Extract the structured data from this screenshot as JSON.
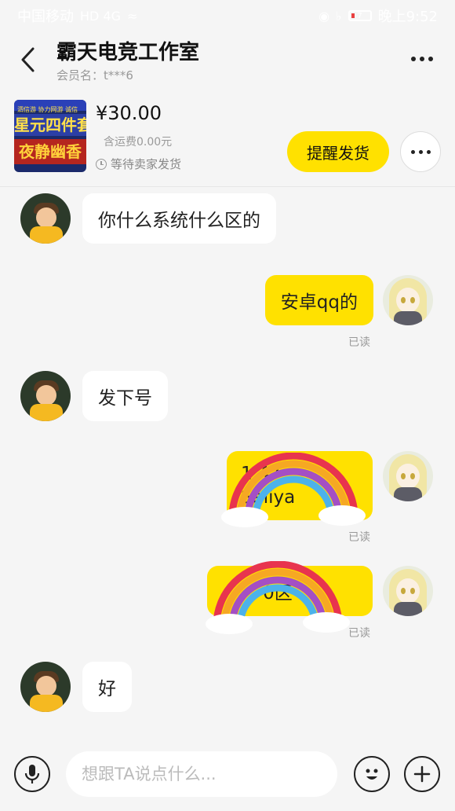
{
  "status_bar": {
    "carrier": "中国移动",
    "network": "HD 4G",
    "battery": "7",
    "time": "晚上9:52"
  },
  "header": {
    "shop_name": "霸天电竞工作室",
    "member_label": "会员名：t***6"
  },
  "order": {
    "thumb_top": "泗信游  协力网游  诚信",
    "thumb_title": "星元四件套",
    "thumb_sub": "夜静幽香",
    "price": "¥30.00",
    "shipping": "含运费0.00元",
    "status": "等待卖家发货",
    "remind_label": "提醒发货"
  },
  "messages": [
    {
      "side": "in",
      "text": "你什么系统什么区的"
    },
    {
      "side": "out",
      "text": "安卓qq的",
      "read": "已读"
    },
    {
      "side": "in",
      "text": "发下号"
    },
    {
      "side": "out",
      "text": "1      47",
      "text2": "Saliya",
      "read": "已读"
    },
    {
      "side": "out",
      "text": "       0区",
      "read": "已读"
    },
    {
      "side": "in",
      "text": "好"
    }
  ],
  "input": {
    "placeholder": "想跟TA说点什么..."
  },
  "colors": {
    "accent": "#ffe100",
    "background": "#f5f5f5"
  }
}
